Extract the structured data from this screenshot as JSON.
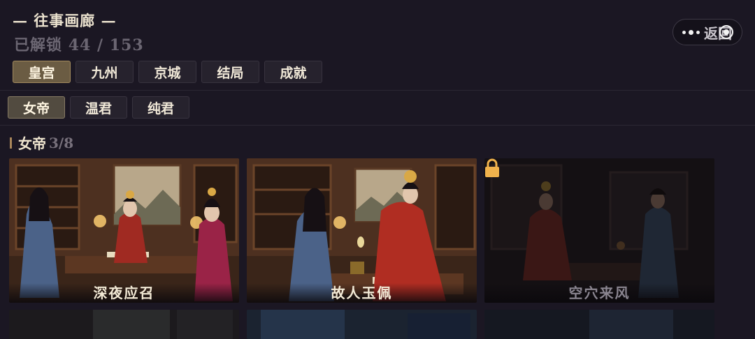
{
  "header": {
    "title": "— 往事画廊 —",
    "unlock_label": "已解锁",
    "unlocked": "44",
    "total": "153",
    "back_label": "返回"
  },
  "main_tabs": [
    "皇宫",
    "九州",
    "京城",
    "结局",
    "成就"
  ],
  "sub_tabs": [
    "女帝",
    "温君",
    "纯君"
  ],
  "section": {
    "name": "女帝",
    "count": "3/8"
  },
  "cards": [
    {
      "title": "深夜应召",
      "locked": false
    },
    {
      "title": "故人玉佩",
      "locked": false
    },
    {
      "title": "空穴来风",
      "locked": true
    }
  ],
  "colors": {
    "accent": "#a8865a",
    "active_tab": "#6b5c43",
    "background": "#1b1723"
  }
}
